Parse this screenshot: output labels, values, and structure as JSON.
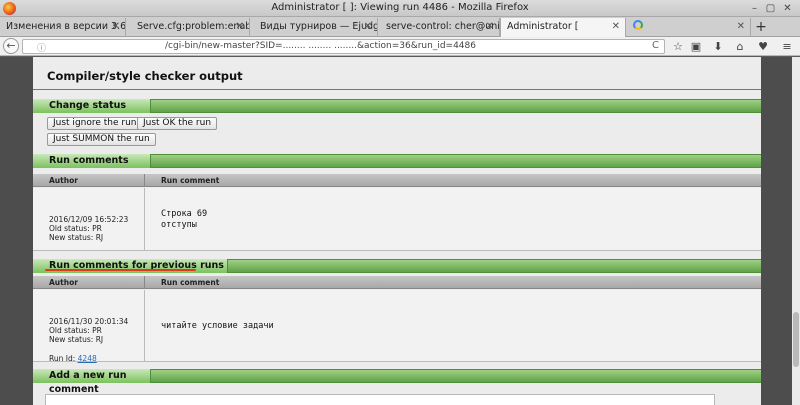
{
  "window": {
    "title": "Administrator [                              ]: Viewing run 4486 - Mozilla Firefox",
    "minimize": "–",
    "restore": "▢",
    "close": "✕"
  },
  "tabs": [
    {
      "label": "Изменения в версии 3.6..."
    },
    {
      "label": "Serve.cfg:problem:enabl..."
    },
    {
      "label": "Виды турниров — Ejudg..."
    },
    {
      "label": "serve-control: cher@unic..."
    },
    {
      "label": "Administrator ["
    },
    {
      "label": ""
    }
  ],
  "tab_close": "✕",
  "new_tab": "+",
  "nav": {
    "back": "←",
    "info": "ⓘ",
    "url": "/cgi-bin/new-master?SID=........ ........ ........&action=36&run_id=4486",
    "reload": "C"
  },
  "toolbar_icons": {
    "star": "☆",
    "reading": "▣",
    "download": "⬇",
    "home": "⌂",
    "pocket": "♥",
    "menu": "≡"
  },
  "page": {
    "compiler_title": "Compiler/style checker output",
    "change_status": {
      "label": "Change status",
      "buttons": [
        "Just ignore the run",
        "Just OK the run",
        "Just SUMMON the run"
      ]
    },
    "run_comments": {
      "label": "Run comments",
      "col_author": "Author",
      "col_comment": "Run comment",
      "rows": [
        {
          "date": "2016/12/09 16:52:23",
          "old_status": "Old status: PR",
          "new_status": "New status: RJ",
          "comment": "Строка 69\nотступы"
        }
      ]
    },
    "prev_comments": {
      "label": "Run comments for previous runs",
      "col_author": "Author",
      "col_comment": "Run comment",
      "rows": [
        {
          "date": "2016/11/30 20:01:34",
          "old_status": "Old status: PR",
          "new_status": "New status: RJ",
          "run_id_label": "Run Id:",
          "run_id": "4248",
          "comment": "читайте условие задачи"
        }
      ]
    },
    "add_comment": {
      "label": "Add a new run comment"
    }
  },
  "colors": {
    "section_green": "#6fb352",
    "header_grey": "#b0b0b0",
    "accent_red": "#e03a1a"
  }
}
